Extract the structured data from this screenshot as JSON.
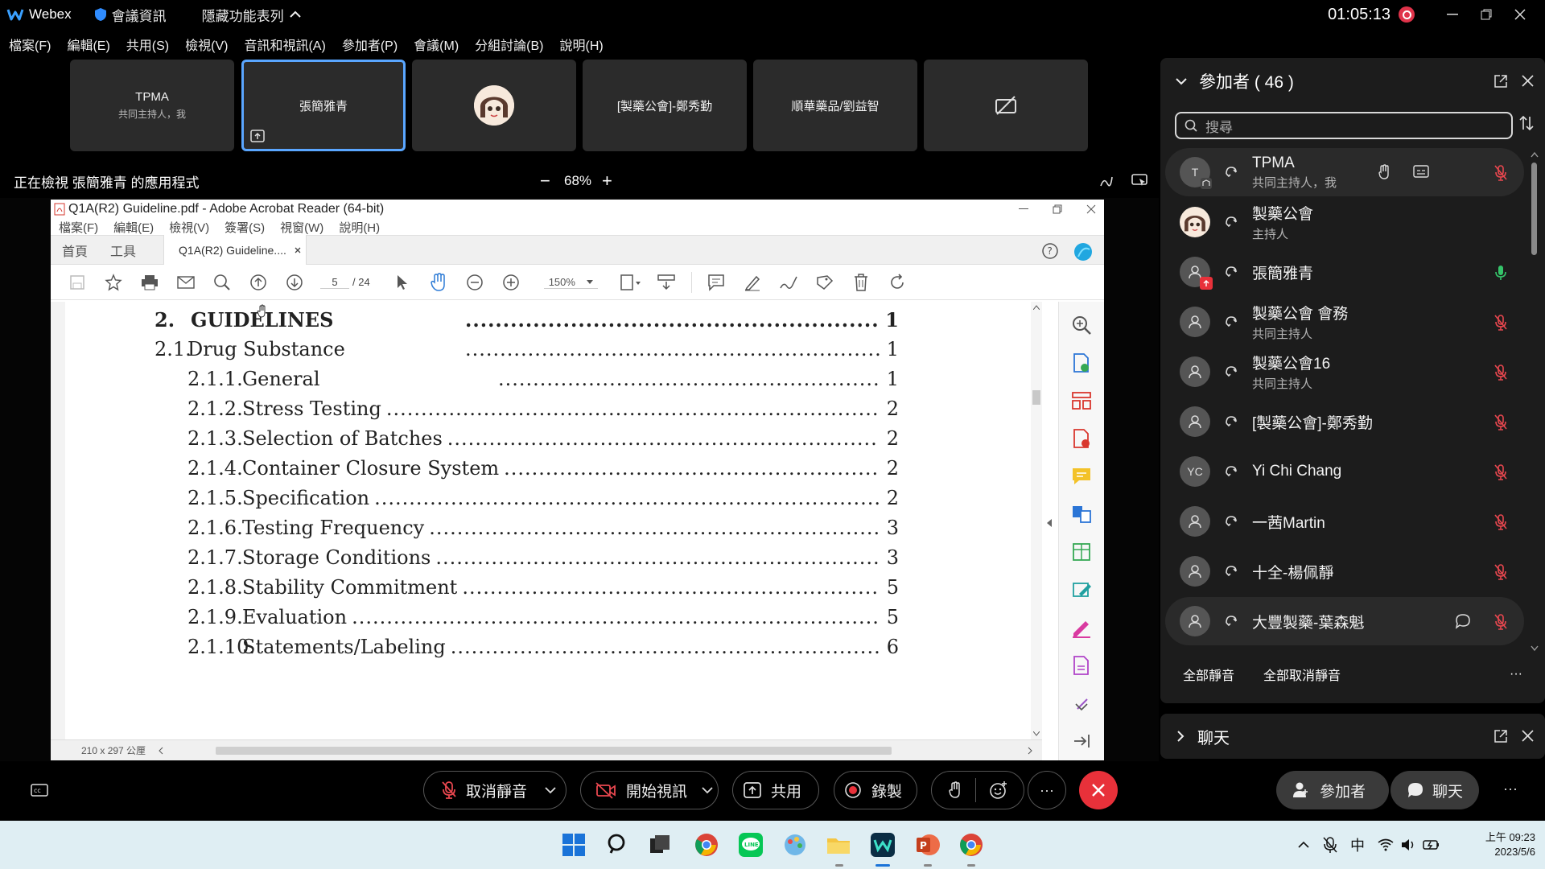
{
  "titlebar": {
    "app_name": "Webex",
    "meeting_info": "會議資訊",
    "hide_menu": "隱藏功能表列",
    "time": "01:05:13"
  },
  "menubar": [
    "檔案(F)",
    "編輯(E)",
    "共用(S)",
    "檢視(V)",
    "音訊和視訊(A)",
    "參加者(P)",
    "會議(M)",
    "分組討論(B)",
    "說明(H)"
  ],
  "thumbnails": [
    {
      "name": "TPMA",
      "sub": "共同主持人，我"
    },
    {
      "name": "張簡雅青",
      "sub": ""
    },
    {
      "name": "",
      "sub": ""
    },
    {
      "name": "[製藥公會]-鄭秀勤",
      "sub": ""
    },
    {
      "name": "順華藥品/劉益智",
      "sub": ""
    },
    {
      "name": "",
      "sub": ""
    }
  ],
  "viewbar": {
    "viewing_text": "正在檢視 張簡雅青 的應用程式",
    "zoom": "68%",
    "zoom_minus": "−",
    "zoom_plus": "+"
  },
  "acrobat": {
    "title": "Q1A(R2) Guideline.pdf - Adobe Acrobat Reader (64-bit)",
    "menu": [
      "檔案(F)",
      "編輯(E)",
      "檢視(V)",
      "簽署(S)",
      "視窗(W)",
      "說明(H)"
    ],
    "tab_home": "首頁",
    "tab_tools": "工具",
    "doc_tab": "Q1A(R2) Guideline....",
    "page_current": "5",
    "page_total": "/ 24",
    "zoom": "150%",
    "page_size": "210 x 297 公厘"
  },
  "toc": [
    {
      "num": "2.",
      "title": "GUIDELINES",
      "page": "1",
      "bold": true
    },
    {
      "num": "2.1.",
      "title": "Drug Substance",
      "page": "1",
      "bold": false
    },
    {
      "num": "2.1.1.",
      "title": "General",
      "page": "1",
      "bold": false
    },
    {
      "num": "2.1.2.",
      "title": "Stress Testing",
      "page": "2",
      "bold": false
    },
    {
      "num": "2.1.3.",
      "title": "Selection of Batches",
      "page": "2",
      "bold": false
    },
    {
      "num": "2.1.4.",
      "title": "Container Closure System",
      "page": "2",
      "bold": false
    },
    {
      "num": "2.1.5.",
      "title": "Specification",
      "page": "2",
      "bold": false
    },
    {
      "num": "2.1.6.",
      "title": "Testing Frequency",
      "page": "3",
      "bold": false
    },
    {
      "num": "2.1.7.",
      "title": "Storage Conditions",
      "page": "3",
      "bold": false
    },
    {
      "num": "2.1.8.",
      "title": "Stability Commitment",
      "page": "5",
      "bold": false
    },
    {
      "num": "2.1.9.",
      "title": "Evaluation",
      "page": "5",
      "bold": false
    },
    {
      "num": "2.1.10.",
      "title": "Statements/Labeling",
      "page": "6",
      "bold": false
    }
  ],
  "participants_panel": {
    "title": "參加者 ( 46 )",
    "search_placeholder": "搜尋",
    "mute_all": "全部靜音",
    "unmute_all": "全部取消靜音",
    "more": "···"
  },
  "participants": [
    {
      "name": "TPMA",
      "role": "共同主持人，我",
      "avatar": "T",
      "mic": "muted"
    },
    {
      "name": "製藥公會",
      "role": "主持人",
      "avatar": "",
      "mic": "none"
    },
    {
      "name": "張簡雅青",
      "role": "",
      "avatar": "",
      "mic": "active"
    },
    {
      "name": "製藥公會 會務",
      "role": "共同主持人",
      "avatar": "",
      "mic": "muted"
    },
    {
      "name": "製藥公會16",
      "role": "共同主持人",
      "avatar": "",
      "mic": "muted"
    },
    {
      "name": "[製藥公會]-鄭秀勤",
      "role": "",
      "avatar": "",
      "mic": "muted"
    },
    {
      "name": "Yi Chi Chang",
      "role": "",
      "avatar": "YC",
      "mic": "muted"
    },
    {
      "name": "一茜Martin",
      "role": "",
      "avatar": "",
      "mic": "muted"
    },
    {
      "name": "十全-楊佩靜",
      "role": "",
      "avatar": "",
      "mic": "muted"
    },
    {
      "name": "大豐製藥-葉森魁",
      "role": "",
      "avatar": "",
      "mic": "muted"
    }
  ],
  "chat_panel": {
    "title": "聊天"
  },
  "controls": {
    "unmute": "取消靜音",
    "start_video": "開始視訊",
    "share": "共用",
    "record": "錄製",
    "participants": "參加者",
    "chat": "聊天",
    "more": "···"
  },
  "taskbar": {
    "ime": "中",
    "time": "上午 09:23",
    "date": "2023/5/6"
  },
  "colors": {
    "accent_blue": "#5aa6ff",
    "end_red": "#e8313a",
    "muted_red": "#e8474f",
    "active_green": "#35c46a"
  }
}
